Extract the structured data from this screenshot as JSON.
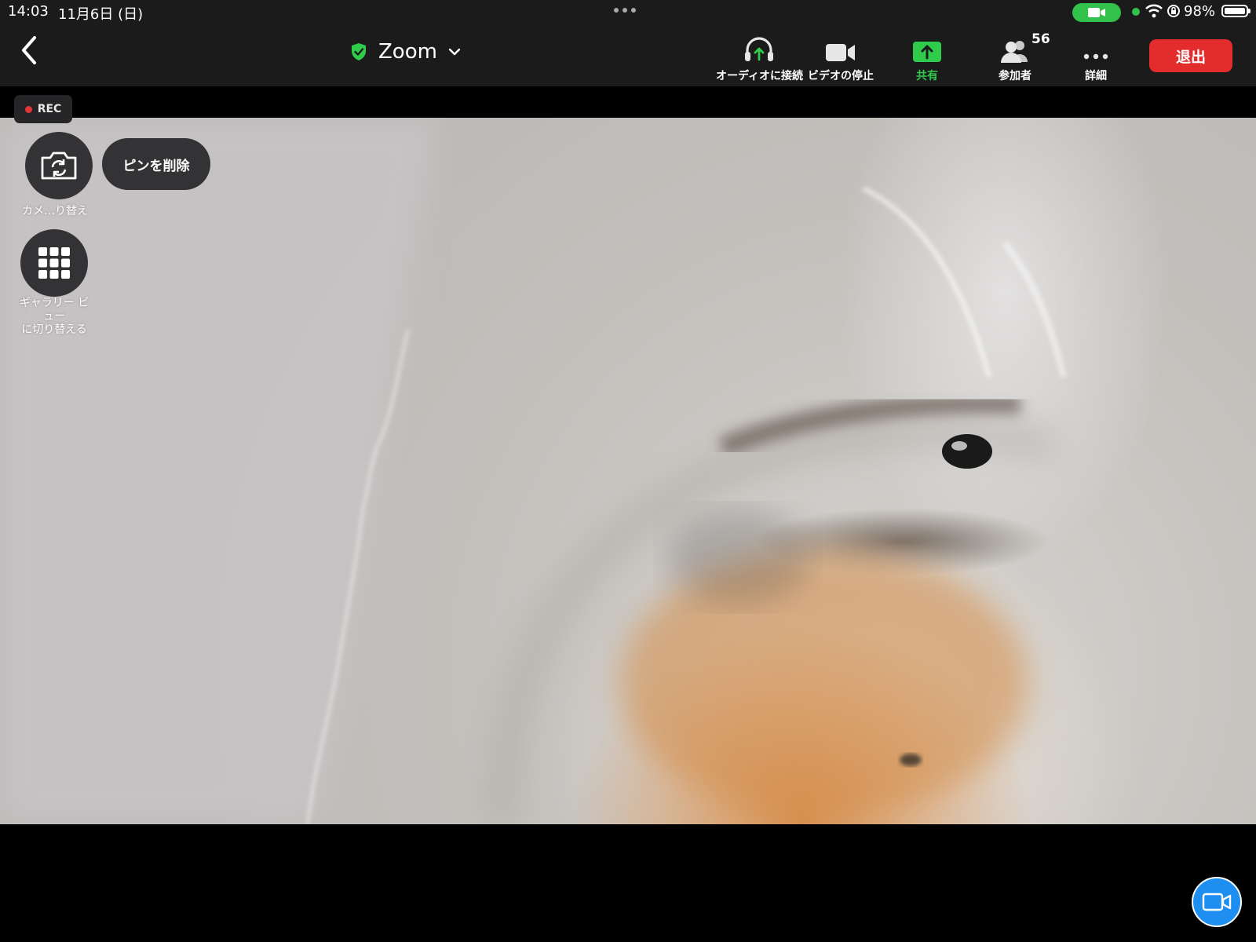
{
  "status_bar": {
    "time": "14:03",
    "date": "11月6日 (日)",
    "battery": "98%"
  },
  "header": {
    "meeting_title": "Zoom",
    "buttons": {
      "audio": "オーディオに接続",
      "video": "ビデオの停止",
      "share": "共有",
      "participants": "参加者",
      "participants_count": "56",
      "more": "詳細"
    },
    "leave": "退出"
  },
  "overlay": {
    "rec": "REC",
    "switch_camera_label": "カメ…り替え",
    "unpin": "ピンを削除",
    "gallery_label_1": "ギャラリー ビ",
    "gallery_label_2": "ュー",
    "gallery_label_3": "に切り替える"
  },
  "colors": {
    "accent_green": "#2ecc4a",
    "leave_red": "#e32c2c",
    "fab_blue": "#1e8ff0",
    "rec_dot": "#e6353a"
  }
}
